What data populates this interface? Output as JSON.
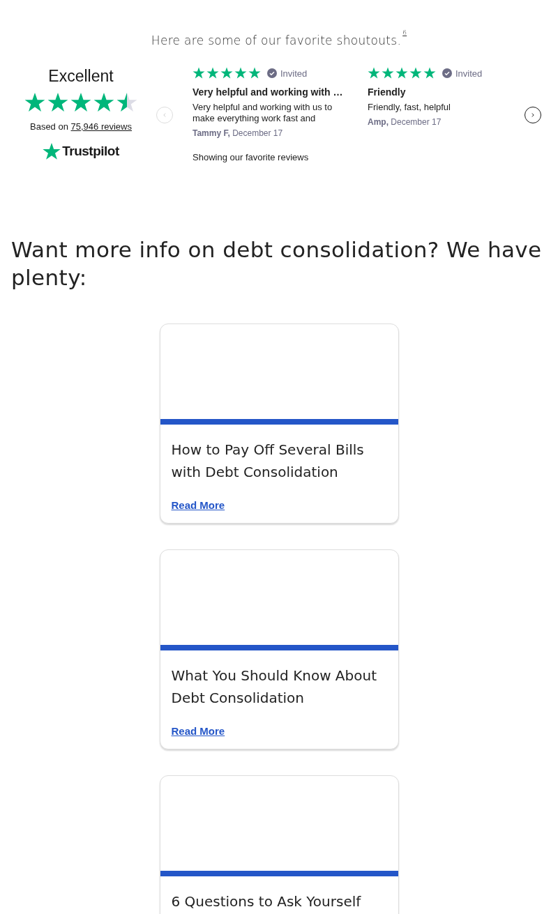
{
  "intro": {
    "text": "Here are some of our favorite shoutouts.",
    "footnote": "6"
  },
  "trustpilot": {
    "rating_label": "Excellent",
    "stars": 4.5,
    "based_on": "Based on",
    "review_count": "75,946 reviews",
    "brand": "Trustpilot",
    "prev_disabled": true,
    "next_disabled": false,
    "reviews": [
      {
        "stars": 5,
        "badge": "Invited",
        "title": "Very helpful and working with …",
        "body": "Very helpful and working with us to make everything work fast and",
        "author": "Tammy F,",
        "date": "December 17"
      },
      {
        "stars": 5,
        "badge": "Invited",
        "title": "Friendly",
        "body": "Friendly, fast, helpful",
        "author": "Amp,",
        "date": "December 17"
      }
    ],
    "footer": "Showing our favorite reviews"
  },
  "section_heading": "Want more info on debt consolidation? We have plenty:",
  "articles": [
    {
      "title": "How to Pay Off Several Bills with Debt Consolidation",
      "link": "Read More"
    },
    {
      "title": "What You Should Know About Debt Consolidation",
      "link": "Read More"
    },
    {
      "title": "6 Questions to Ask Yourself"
    }
  ]
}
